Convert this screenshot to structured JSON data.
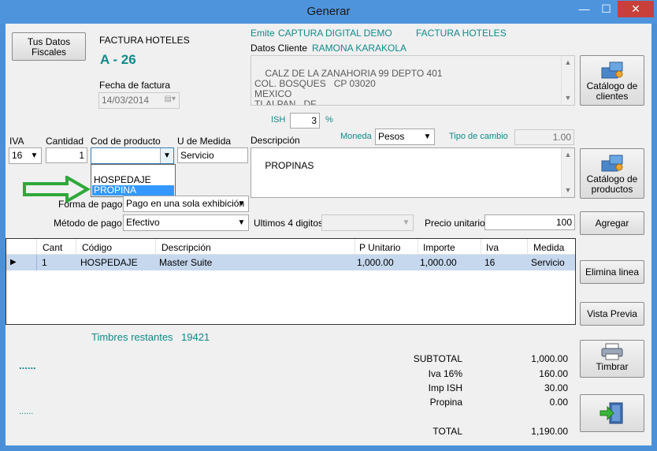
{
  "window": {
    "title": "Generar",
    "minimize": "—",
    "maximize": "☐",
    "close": "✕"
  },
  "header": {
    "tus_datos_fiscales": "Tus Datos Fiscales",
    "factura_label": "FACTURA HOTELES",
    "folio": "A - 26",
    "fecha_label": "Fecha de factura",
    "fecha_value": "14/03/2014",
    "emite_label": "Emite",
    "emite_value": "CAPTURA DIGITAL DEMO",
    "emite_tipo": "FACTURA HOTELES",
    "datos_cliente_label": "Datos Cliente",
    "cliente_nombre": "RAMONA KARAKOLA",
    "cliente_direccion": "CALZ DE LA ZANAHORIA 99 DEPTO 401\nCOL. BOSQUES   CP 03020\nMEXICO\nTLALPAN   DF",
    "catalogo_clientes": "Catálogo de clientes",
    "ish_label": "ISH",
    "ish_value": "3",
    "ish_pct": "%"
  },
  "product": {
    "iva_label": "IVA",
    "iva_value": "16",
    "cantidad_label": "Cantidad",
    "cantidad_value": "1",
    "cod_label": "Cod de producto",
    "cod_value": "",
    "cod_options": [
      "HOSPEDAJE",
      "PROPINA"
    ],
    "cod_highlighted": "PROPINA",
    "udm_label": "U de Medida",
    "udm_value": "Servicio",
    "descripcion_label": "Descripción",
    "descripcion_value": "PROPINAS",
    "moneda_label": "Moneda",
    "moneda_value": "Pesos",
    "tipo_cambio_label": "Tipo de cambio",
    "tipo_cambio_value": "1.00",
    "catalogo_productos": "Catálogo de productos",
    "forma_pago_label": "Forma de pago",
    "forma_pago_value": "Pago en una sola exhibición",
    "metodo_pago_label": "Método de pago",
    "metodo_pago_value": "Efectivo",
    "ultimos4_label": "Ultimos 4 digitos",
    "ultimos4_value": "",
    "precio_label": "Precio unitario",
    "precio_value": "100",
    "agregar": "Agregar"
  },
  "grid": {
    "columns": [
      "Cant",
      "Código",
      "Descripción",
      "P Unitario",
      "Importe",
      "Iva",
      "Medida"
    ],
    "rows": [
      {
        "cant": "1",
        "codigo": "HOSPEDAJE",
        "descripcion": "Master Suite",
        "punitario": "1,000.00",
        "importe": "1,000.00",
        "iva": "16",
        "medida": "Servicio"
      }
    ],
    "row_marker": "▶"
  },
  "actions": {
    "elimina_linea": "Elimina linea",
    "vista_previa": "Vista Previa",
    "timbrar": "Timbrar"
  },
  "footer": {
    "timbres_label": "Timbres restantes",
    "timbres_value": "19421",
    "dots1": "......",
    "dots2": "......"
  },
  "totals": {
    "subtotal_label": "SUBTOTAL",
    "subtotal_value": "1,000.00",
    "iva_label": "Iva 16%",
    "iva_value": "160.00",
    "ish_label": "Imp ISH",
    "ish_value": "30.00",
    "propina_label": "Propina",
    "propina_value": "0.00",
    "total_label": "TOTAL",
    "total_value": "1,190.00"
  },
  "colors": {
    "titlebar": "#4e94dd",
    "teal": "#118a8a",
    "arrow": "#2fa83a",
    "selection": "#3399ff"
  }
}
